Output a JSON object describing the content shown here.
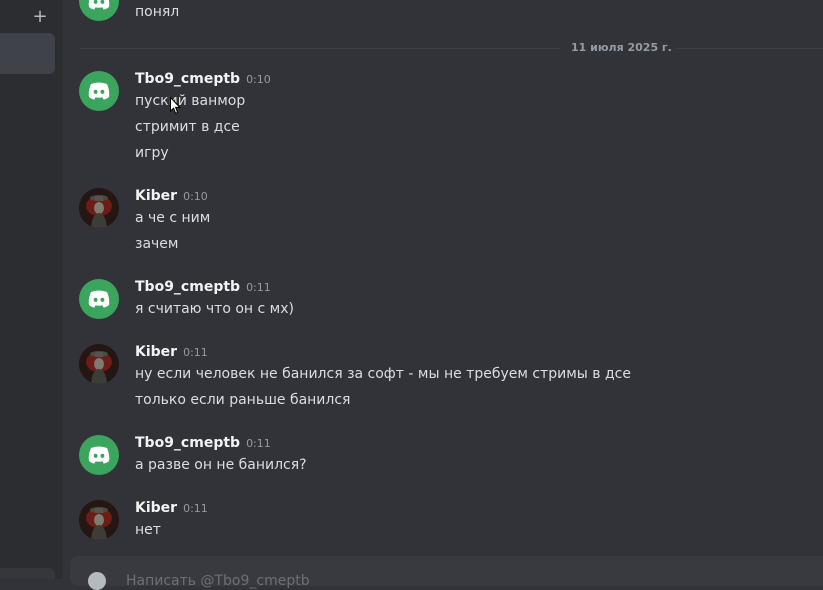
{
  "sidebar": {
    "add_label": "+"
  },
  "date_divider": "11 июля 2025 г.",
  "messages": [
    {
      "author": "",
      "time": "",
      "lines": [
        "понял"
      ]
    },
    {
      "author": "Tbo9_cmeptb",
      "time": "0:10",
      "lines": [
        "пуский ванмор",
        "стримит в дсе",
        "игру"
      ]
    },
    {
      "author": "Kiber",
      "time": "0:10",
      "lines": [
        "а че с ним",
        "зачем"
      ]
    },
    {
      "author": "Tbo9_cmeptb",
      "time": "0:11",
      "lines": [
        "я считаю что он с мх)"
      ]
    },
    {
      "author": "Kiber",
      "time": "0:11",
      "lines": [
        "ну если человек не банился за софт - мы не требуем стримы в дсе",
        "только если раньше банился"
      ]
    },
    {
      "author": "Tbo9_cmeptb",
      "time": "0:11",
      "lines": [
        "а разве он не банился?"
      ]
    },
    {
      "author": "Kiber",
      "time": "0:11",
      "lines": [
        "нет"
      ]
    }
  ],
  "composer": {
    "placeholder": "Написать @Tbo9_cmeptb"
  },
  "colors": {
    "discord_green": "#3ba55d",
    "background": "#313338",
    "sidebar": "#2b2d31"
  }
}
